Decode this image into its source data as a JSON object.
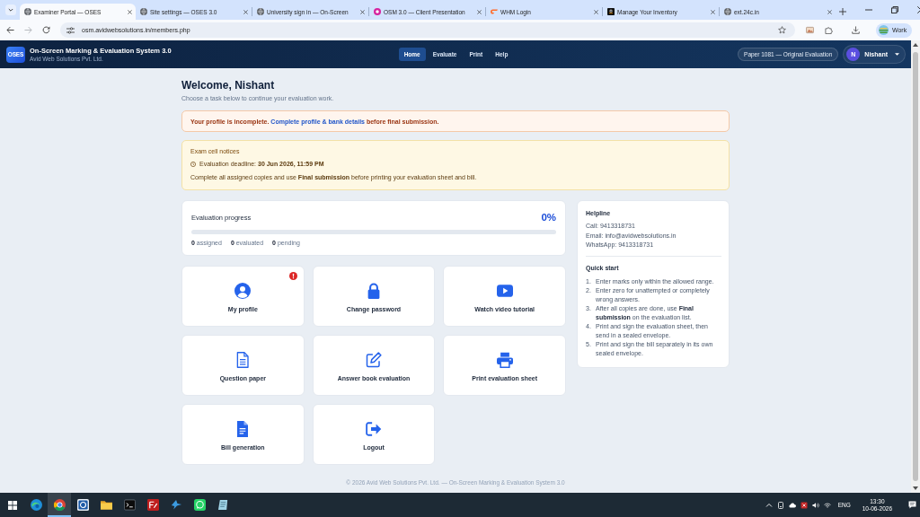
{
  "browser": {
    "tabs": [
      {
        "title": "Examiner Portal — OSES",
        "kind": "globe",
        "selected": true
      },
      {
        "title": "Site settings — OSES 3.0",
        "kind": "globe",
        "selected": false
      },
      {
        "title": "University sign in — On-Screen",
        "kind": "globe",
        "selected": false
      },
      {
        "title": "OSM 3.0 — Client Presentation",
        "kind": "badge",
        "selected": false
      },
      {
        "title": "WHM Login",
        "kind": "logo",
        "selected": false
      },
      {
        "title": "Manage Your Inventory",
        "kind": "square",
        "selected": false
      },
      {
        "title": "ext.24c.in",
        "kind": "globe",
        "selected": false
      }
    ],
    "nav_buttons": [
      {
        "kind": "back",
        "disabled": false
      },
      {
        "kind": "forward",
        "disabled": true
      },
      {
        "kind": "reload",
        "disabled": false
      }
    ],
    "address": "osm.avidwebsolutions.in/members.php",
    "profile": "Work"
  },
  "header": {
    "logo": "OSES",
    "title": "On-Screen Marking & Evaluation System 3.0",
    "subtitle": "Avid Web Solutions Pvt. Ltd.",
    "nav": [
      {
        "label": "Home",
        "selected": true
      },
      {
        "label": "Evaluate",
        "selected": false
      },
      {
        "label": "Print",
        "selected": false
      },
      {
        "label": "Help",
        "selected": false
      }
    ],
    "paper": "Paper 1081 — Original Evaluation",
    "user": {
      "initial": "N",
      "name": "Nishant"
    }
  },
  "welcome": {
    "title": "Welcome, Nishant",
    "subtitle": "Choose a task below to continue your evaluation work."
  },
  "profile_alert": {
    "text_before": "Your profile is incomplete. ",
    "link": "Complete profile & bank details",
    "text_after": " before final submission."
  },
  "notices": {
    "title": "Exam cell notices",
    "deadline": "Evaluation deadline: **30 Jun 2026, 11:59 PM**",
    "message": "Complete all assigned copies and use **Final submission** before printing your evaluation sheet and bill."
  },
  "progress": {
    "title": "Evaluation progress",
    "percent": "0%",
    "level": 0,
    "stats": [
      "**0** assigned",
      "**0** evaluated",
      "**0** pending"
    ]
  },
  "tiles": [
    {
      "label": "My profile",
      "kind": "profile",
      "badge": true
    },
    {
      "label": "Change password",
      "kind": "password",
      "badge": false
    },
    {
      "label": "Watch video tutorial",
      "kind": "video",
      "badge": false
    },
    {
      "label": "Question paper",
      "kind": "document",
      "badge": false
    },
    {
      "label": "Answer book evaluation",
      "kind": "edit",
      "badge": false
    },
    {
      "label": "Print evaluation sheet",
      "kind": "print",
      "badge": false
    },
    {
      "label": "Bill generation",
      "kind": "bill",
      "badge": false
    },
    {
      "label": "Logout",
      "kind": "logout",
      "badge": false
    }
  ],
  "helpline": {
    "title": "Helpline",
    "lines": [
      "Call: 9413318731",
      "Email: info@avidwebsolutions.in",
      "WhatsApp: 9413318731"
    ]
  },
  "quick_start": {
    "title": "Quick start",
    "steps": [
      {
        "number": "1.",
        "text": "Enter marks only within the allowed range."
      },
      {
        "number": "2.",
        "text": "Enter zero for unattempted or completely wrong answers."
      },
      {
        "number": "3.",
        "text": "After all copies are done, use **Final submission** on the evaluation list."
      },
      {
        "number": "4.",
        "text": "Print and sign the evaluation sheet, then send in a sealed envelope."
      },
      {
        "number": "5.",
        "text": "Print and sign the bill separately in its own sealed envelope."
      }
    ]
  },
  "footer": "© 2026 Avid Web Solutions Pvt. Ltd. — On-Screen Marking & Evaluation System 3.0",
  "taskbar": {
    "apps": [
      {
        "kind": "wave",
        "selected": false
      },
      {
        "kind": "ring",
        "selected": true
      },
      {
        "kind": "blue-square",
        "selected": false
      },
      {
        "kind": "folder",
        "selected": false
      },
      {
        "kind": "terminal",
        "selected": false
      },
      {
        "kind": "red-square",
        "selected": false
      },
      {
        "kind": "bird",
        "selected": false
      },
      {
        "kind": "chat",
        "selected": false
      },
      {
        "kind": "notepad",
        "selected": false
      }
    ],
    "language": "ENG",
    "time": "13:30",
    "date": "10-06-2026"
  }
}
